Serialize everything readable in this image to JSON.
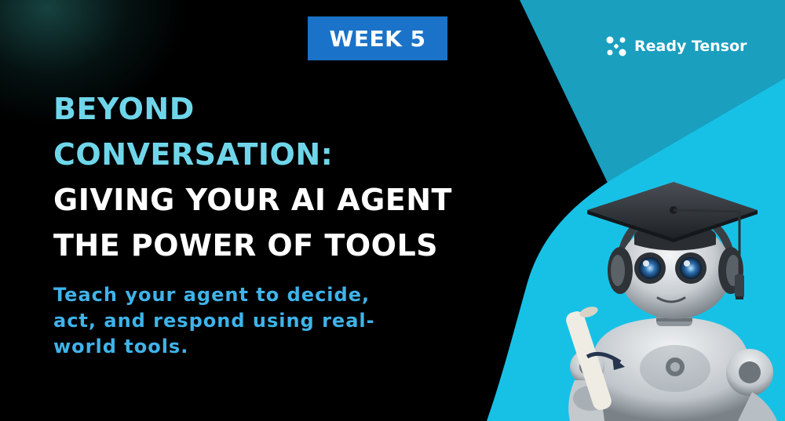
{
  "badge": {
    "label": "WEEK 5"
  },
  "brand": {
    "name": "Ready Tensor",
    "logo_icon": "ready-tensor-logo-icon"
  },
  "headline": {
    "line1": "BEYOND",
    "line2": "CONVERSATION:",
    "line3": "GIVING YOUR AI AGENT",
    "line4": "THE POWER OF TOOLS"
  },
  "subtitle": {
    "line1": "Teach your agent to decide,",
    "line2": "act, and respond using real-",
    "line3": "world tools."
  },
  "colors": {
    "background": "#000000",
    "accent_cyan": "#6fd6ea",
    "subtitle_blue": "#3fb3ea",
    "badge_blue": "#1a73c8",
    "panel_teal": "#1a9fbf",
    "panel_cyan": "#17c1e6"
  },
  "illustration": {
    "icon": "graduate-robot-illustration"
  }
}
